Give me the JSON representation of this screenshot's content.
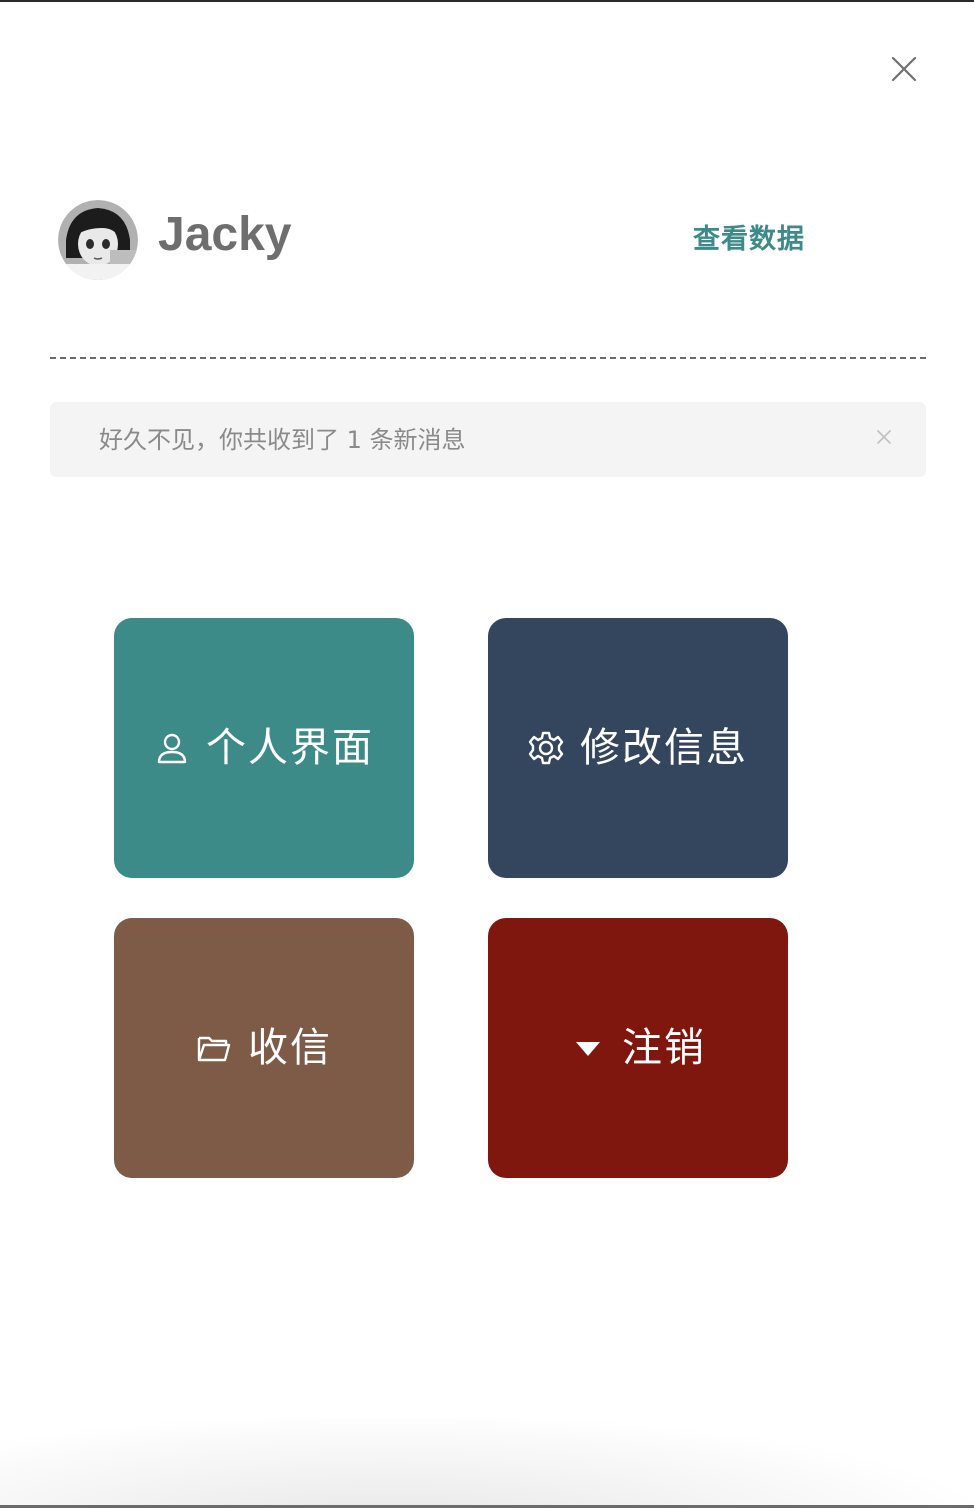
{
  "user": {
    "name": "Jacky",
    "view_data_label": "查看数据"
  },
  "alert": {
    "message": "好久不见，你共收到了 1 条新消息"
  },
  "tiles": [
    {
      "label": "个人界面",
      "icon": "user-icon",
      "color": "#3c8b89"
    },
    {
      "label": "修改信息",
      "icon": "gear-icon",
      "color": "#34455e"
    },
    {
      "label": "收信",
      "icon": "folder-icon",
      "color": "#7d5b47"
    },
    {
      "label": "注销",
      "icon": "caret-down-icon",
      "color": "#80170f"
    }
  ],
  "colors": {
    "accent_teal": "#3d8a8a",
    "username_gray": "#6e6e6e",
    "alert_bg": "#f4f4f5",
    "alert_text": "#8a8a8a"
  }
}
